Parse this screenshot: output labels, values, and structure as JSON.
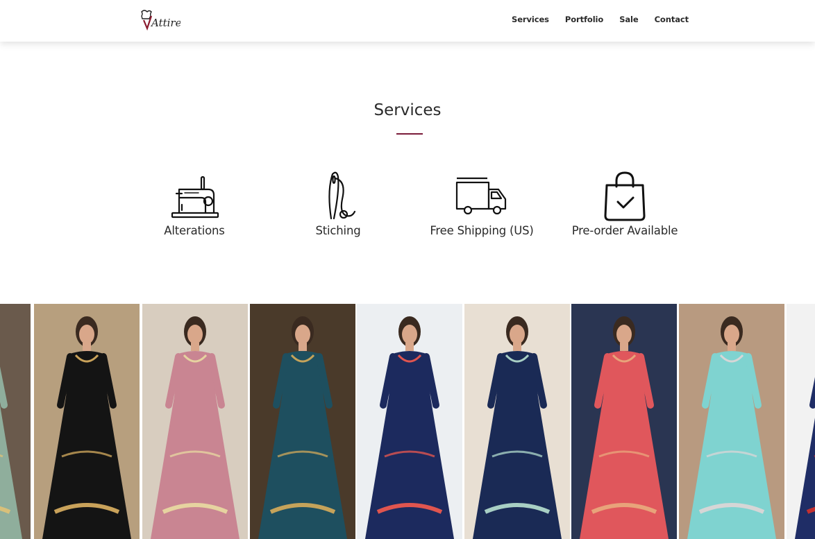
{
  "brand": {
    "logo_text": "Attire"
  },
  "nav": {
    "links": [
      {
        "label": "Services"
      },
      {
        "label": "Portfolio"
      },
      {
        "label": "Sale"
      },
      {
        "label": "Contact"
      }
    ]
  },
  "services": {
    "title": "Services",
    "accent_color": "#7a1b3a",
    "items": [
      {
        "label": "Alterations",
        "icon": "sewing-machine-icon"
      },
      {
        "label": "Stiching",
        "icon": "needle-thread-icon"
      },
      {
        "label": "Free Shipping (US)",
        "icon": "delivery-truck-icon"
      },
      {
        "label": "Pre-order Available",
        "icon": "shopping-bag-check-icon"
      }
    ]
  },
  "gallery": {
    "items": [
      {
        "dress_color": "#8fae9c",
        "background": "#6a5a4c",
        "accent": "#d8c07a"
      },
      {
        "dress_color": "#141414",
        "background": "#b79f7e",
        "accent": "#c9a25a"
      },
      {
        "dress_color": "#c98592",
        "background": "#d8cdbf",
        "accent": "#e6d3a0"
      },
      {
        "dress_color": "#1e4f5f",
        "background": "#4a3a2a",
        "accent": "#c5a35a"
      },
      {
        "dress_color": "#1c2a5e",
        "background": "#eceff2",
        "accent": "#e0554f"
      },
      {
        "dress_color": "#1a2a55",
        "background": "#e8dfd3",
        "accent": "#a8cfc4"
      },
      {
        "dress_color": "#e0575c",
        "background": "#2a3552",
        "accent": "#e8a37a"
      },
      {
        "dress_color": "#7fd3d0",
        "background": "#b89a80",
        "accent": "#d6d6d6"
      },
      {
        "dress_color": "#1f2d66",
        "background": "#f2f2f2",
        "accent": "#c43030"
      }
    ]
  }
}
